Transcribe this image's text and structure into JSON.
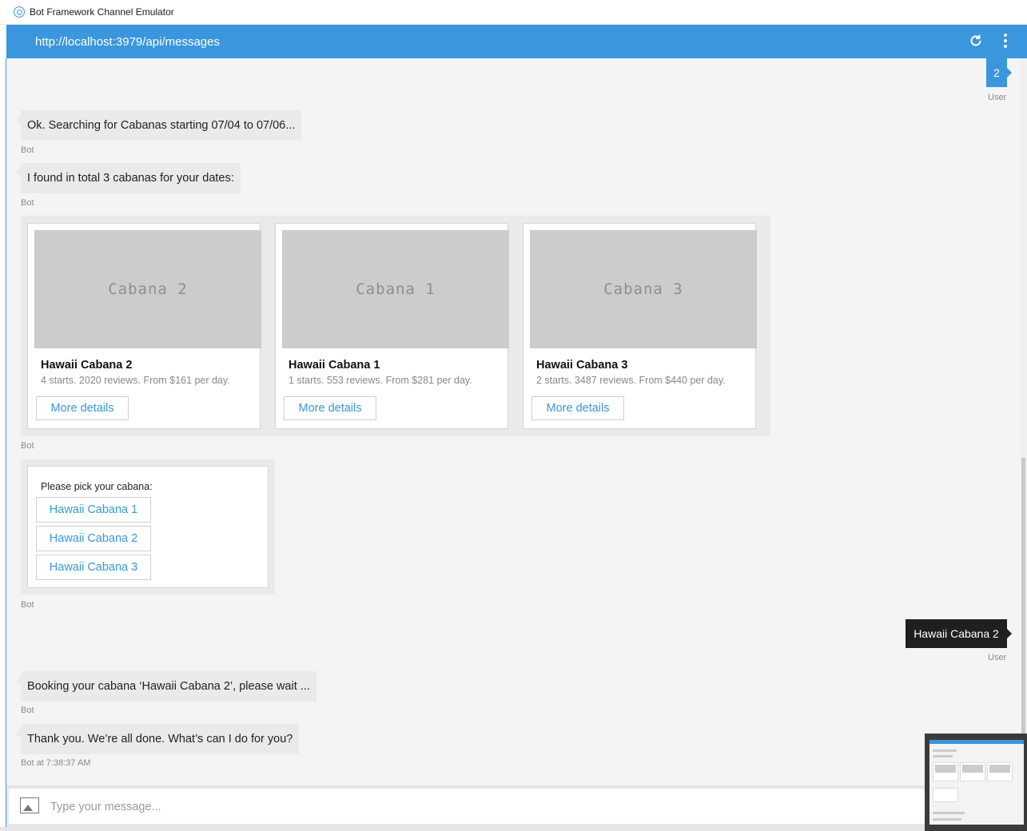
{
  "window": {
    "title": "Bot Framework Channel Emulator"
  },
  "header": {
    "url": "http://localhost:3979/api/messages"
  },
  "messages": {
    "user1": {
      "text": "2",
      "sender": "User"
    },
    "bot1": {
      "text": "Ok. Searching for Cabanas starting 07/04 to 07/06...",
      "sender": "Bot"
    },
    "bot2": {
      "text": "I found in total 3 cabanas for your dates:",
      "sender": "Bot"
    },
    "carousel_sender": "Bot",
    "cards": [
      {
        "image_label": "Cabana 2",
        "title": "Hawaii Cabana 2",
        "subtitle": "4 starts. 2020 reviews. From $161 per day.",
        "button": "More details"
      },
      {
        "image_label": "Cabana 1",
        "title": "Hawaii Cabana 1",
        "subtitle": "1 starts. 553 reviews. From $281 per day.",
        "button": "More details"
      },
      {
        "image_label": "Cabana 3",
        "title": "Hawaii Cabana 3",
        "subtitle": "2 starts. 3487 reviews. From $440 per day.",
        "button": "More details"
      }
    ],
    "picker": {
      "text": "Please pick your cabana:",
      "options": [
        "Hawaii Cabana 1",
        "Hawaii Cabana 2",
        "Hawaii Cabana 3"
      ],
      "sender": "Bot"
    },
    "user2": {
      "text": "Hawaii Cabana 2",
      "sender": "User"
    },
    "bot3": {
      "text": "Booking your cabana ‘Hawaii Cabana 2’, please wait ...",
      "sender": "Bot"
    },
    "bot4": {
      "text": "Thank you. We’re all done. What’s can I do for you?",
      "sender": "Bot at 7:38:37 AM"
    }
  },
  "input": {
    "placeholder": "Type your message..."
  },
  "icons": {
    "app": "emulator-logo-icon",
    "refresh": "refresh-icon",
    "menu": "more-vertical-icon",
    "attach": "image-upload-icon"
  },
  "colors": {
    "accent": "#3a96dd",
    "user_dark": "#1f1f1f",
    "bubble_bot": "#eaeaea"
  }
}
